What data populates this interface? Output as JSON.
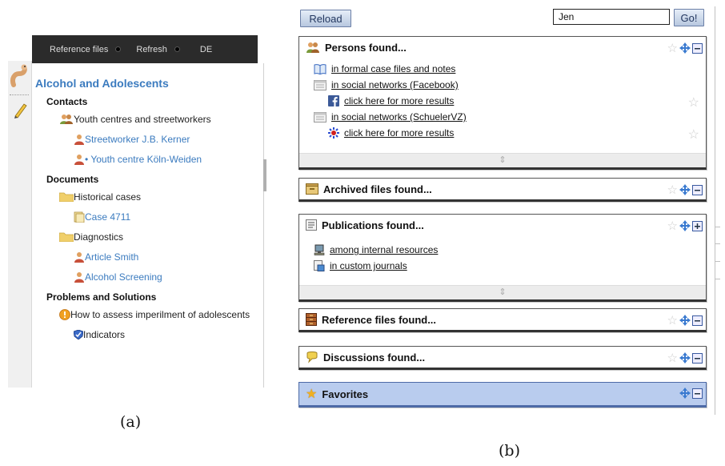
{
  "panel_a": {
    "topbar": {
      "items": [
        "Reference files",
        "Refresh",
        "DE"
      ]
    },
    "title": "Alcohol and Adolescents",
    "sections": {
      "contacts": "Contacts",
      "youth_centres": "Youth centres and streetworkers",
      "streetworker": "Streetworker J.B. Kerner",
      "youth_centre": "• Youth centre Köln-Weiden",
      "documents": "Documents",
      "historical_cases": "Historical cases",
      "case_4711": "Case 4711",
      "diagnostics": "Diagnostics",
      "article_smith": "Article Smith",
      "alcohol_screening": "Alcohol Screening",
      "problems": "Problems and Solutions",
      "how_to_assess": "How to assess imperilment of adolescents",
      "indicators": "Indicators"
    },
    "caption": "(a)"
  },
  "panel_b": {
    "reload_label": "Reload",
    "search_value": "Jen",
    "go_label": "Go!",
    "persons": {
      "title": "Persons found...",
      "items": [
        "in formal case files and notes",
        "in social networks (Facebook)",
        "click here for more results",
        "in social networks (SchuelerVZ)",
        "click here for more results"
      ]
    },
    "archived": {
      "title": "Archived files found..."
    },
    "publications": {
      "title": "Publications found...",
      "items": [
        "among internal resources",
        "in custom journals"
      ]
    },
    "reference": {
      "title": "Reference files found..."
    },
    "discussions": {
      "title": "Discussions found..."
    },
    "favorites": {
      "title": "Favorites"
    },
    "caption": "(b)"
  },
  "colors": {
    "link_blue": "#3b7bbf",
    "topbar_dark": "#2b2b2b",
    "favorites_bg": "#b9ccee"
  }
}
